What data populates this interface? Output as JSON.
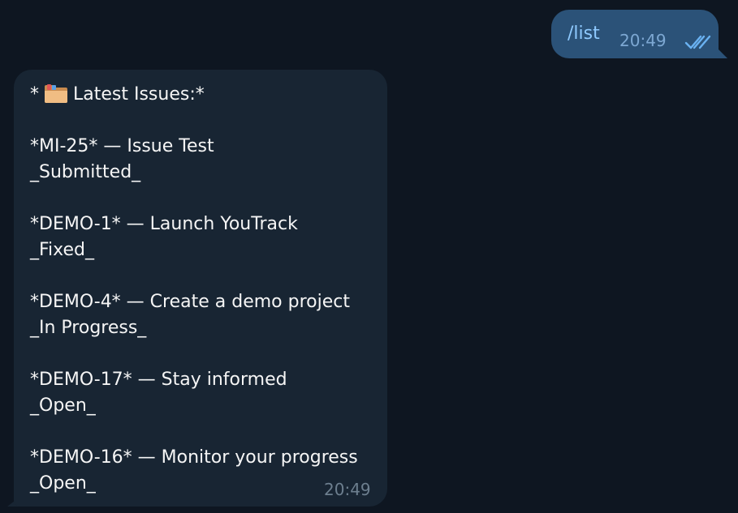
{
  "outgoing": {
    "text": "/list",
    "time": "20:49",
    "status_icon": "double-check-icon"
  },
  "incoming": {
    "header_prefix": "*",
    "header_icon": "folder-icon",
    "header_text": "Latest Issues:*",
    "lines": [
      "*MI-25* — Issue Test",
      "_Submitted_",
      "*DEMO-1* — Launch YouTrack",
      "_Fixed_",
      "*DEMO-4* — Create a demo project",
      "_In Progress_",
      "*DEMO-17* — Stay informed",
      "_Open_",
      "*DEMO-16* — Monitor your progress",
      "_Open_"
    ],
    "time": "20:49"
  },
  "colors": {
    "background": "#0e1621",
    "outgoing_bubble": "#2b5278",
    "incoming_bubble": "#182533",
    "outgoing_text": "#8fcaff",
    "incoming_text": "#f5f5f5",
    "check_color": "#6ab2f2"
  }
}
